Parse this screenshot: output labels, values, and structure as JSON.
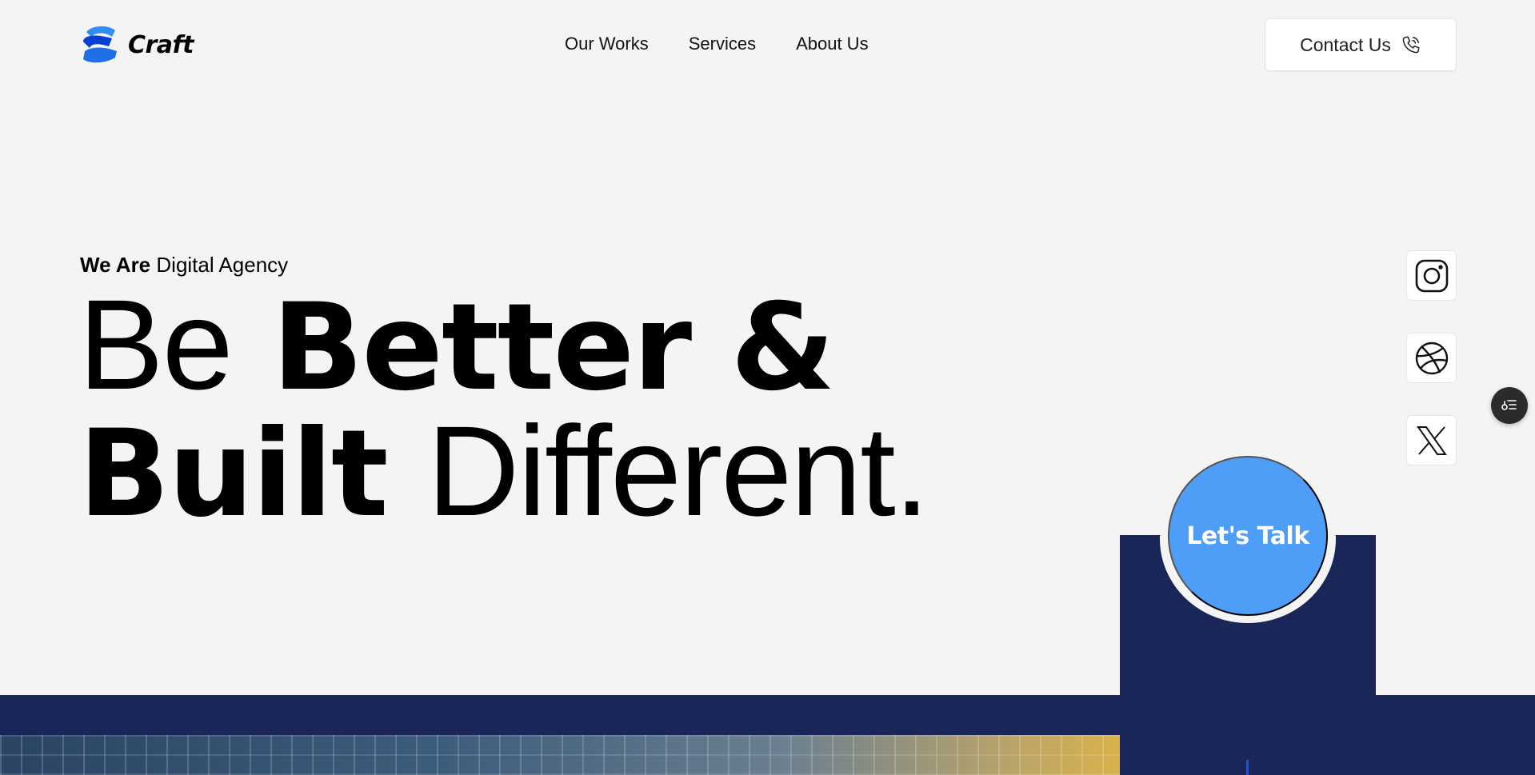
{
  "header": {
    "logo_text": "Craft",
    "nav": [
      "Our Works",
      "Services",
      "About Us"
    ],
    "contact_label": "Contact Us"
  },
  "hero": {
    "tagline_bold": "We Are",
    "tagline_rest": "Digital Agency",
    "line1_light": "Be",
    "line1_bold": "Better &",
    "line2_bold": "Built",
    "line2_light": "Different."
  },
  "social": [
    "instagram-icon",
    "dribbble-icon",
    "x-icon"
  ],
  "cta": {
    "label": "Let's Talk"
  },
  "colors": {
    "background": "#f4f4f4",
    "navy": "#1a2558",
    "cta_blue": "#4e9ef8",
    "logo_blue": "#1f6fe6"
  }
}
